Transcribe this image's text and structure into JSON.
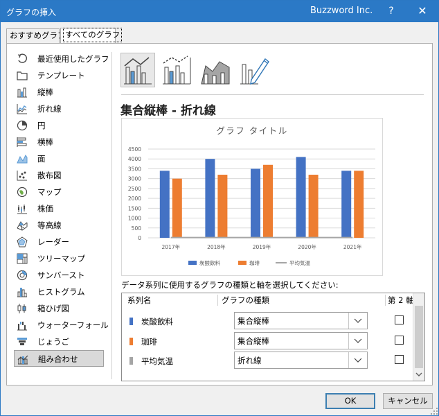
{
  "window": {
    "title": "グラフの挿入",
    "account": "Buzzword Inc.",
    "help": "?",
    "close": "✕"
  },
  "tabs": [
    {
      "label": "おすすめグラフ",
      "active": false
    },
    {
      "label": "すべてのグラフ",
      "active": true
    }
  ],
  "sidebar": {
    "items": [
      {
        "label": "最近使用したグラフ",
        "icon": "recent-icon"
      },
      {
        "label": "テンプレート",
        "icon": "folder-icon"
      },
      {
        "label": "縦棒",
        "icon": "column-chart-icon"
      },
      {
        "label": "折れ線",
        "icon": "line-chart-icon"
      },
      {
        "label": "円",
        "icon": "pie-chart-icon"
      },
      {
        "label": "横棒",
        "icon": "bar-chart-icon"
      },
      {
        "label": "面",
        "icon": "area-chart-icon"
      },
      {
        "label": "散布図",
        "icon": "scatter-chart-icon"
      },
      {
        "label": "マップ",
        "icon": "map-chart-icon"
      },
      {
        "label": "株価",
        "icon": "stock-chart-icon"
      },
      {
        "label": "等高線",
        "icon": "surface-chart-icon"
      },
      {
        "label": "レーダー",
        "icon": "radar-chart-icon"
      },
      {
        "label": "ツリーマップ",
        "icon": "treemap-chart-icon"
      },
      {
        "label": "サンバースト",
        "icon": "sunburst-chart-icon"
      },
      {
        "label": "ヒストグラム",
        "icon": "histogram-chart-icon"
      },
      {
        "label": "箱ひげ図",
        "icon": "boxwhisker-chart-icon"
      },
      {
        "label": "ウォーターフォール",
        "icon": "waterfall-chart-icon"
      },
      {
        "label": "じょうご",
        "icon": "funnel-chart-icon"
      },
      {
        "label": "組み合わせ",
        "icon": "combo-chart-icon",
        "selected": true
      }
    ]
  },
  "subtypes": [
    {
      "icon": "combo-column-line-icon",
      "selected": true
    },
    {
      "icon": "combo-column-line-secondary-icon",
      "selected": false
    },
    {
      "icon": "combo-area-column-icon",
      "selected": false
    },
    {
      "icon": "combo-custom-icon",
      "selected": false
    }
  ],
  "chart_heading": "集合縦棒 - 折れ線",
  "chart_data": {
    "type": "bar",
    "title": "グラフ タイトル",
    "categories": [
      "2017年",
      "2018年",
      "2019年",
      "2020年",
      "2021年"
    ],
    "series": [
      {
        "name": "炭酸飲料",
        "values": [
          3400,
          4000,
          3500,
          4100,
          3400
        ],
        "color": "#4472c4",
        "kind": "bar"
      },
      {
        "name": "珈琲",
        "values": [
          3000,
          3200,
          3700,
          3200,
          3400
        ],
        "color": "#ed7d31",
        "kind": "bar"
      },
      {
        "name": "平均気温",
        "values": [
          15,
          15,
          15,
          15,
          15
        ],
        "color": "#a5a5a5",
        "kind": "line"
      }
    ],
    "ylim": [
      0,
      4500
    ],
    "yticks": [
      "0",
      "500",
      "1000",
      "1500",
      "2000",
      "2500",
      "3000",
      "3500",
      "4000",
      "4500"
    ],
    "grid": true,
    "legend": "bottom"
  },
  "series_prompt": "データ系列に使用するグラフの種類と軸を選択してください:",
  "grid": {
    "headers": {
      "name": "系列名",
      "type": "グラフの種類",
      "axis": "第 2 軸"
    },
    "rows": [
      {
        "name": "炭酸飲料",
        "color": "#4472c4",
        "type": "集合縦棒",
        "secondary": false
      },
      {
        "name": "珈琲",
        "color": "#ed7d31",
        "type": "集合縦棒",
        "secondary": false
      },
      {
        "name": "平均気温",
        "color": "#a5a5a5",
        "type": "折れ線",
        "secondary": false
      }
    ]
  },
  "buttons": {
    "ok": "OK",
    "cancel": "キャンセル"
  }
}
